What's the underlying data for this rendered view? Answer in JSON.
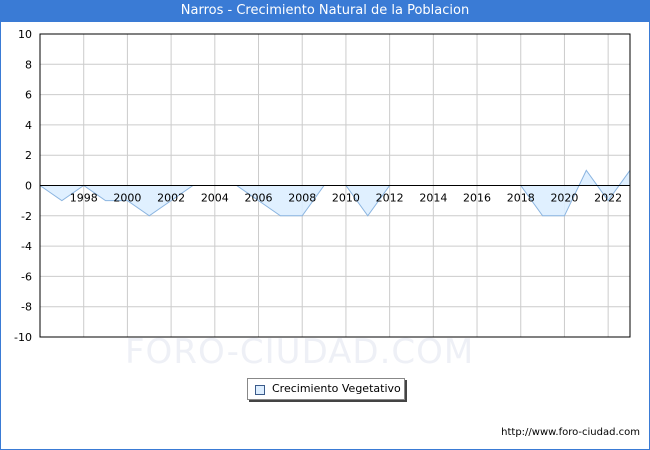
{
  "header": {
    "title": "Narros - Crecimiento Natural de la Poblacion"
  },
  "watermark": "FORO-CIUDAD.COM",
  "footer": {
    "url": "http://www.foro-ciudad.com"
  },
  "colors": {
    "title_bar": "#3a7bd5",
    "area_fill": "#ddeeff",
    "area_line": "#8ab4e0",
    "zero_line": "#000000",
    "grid": "#cccccc"
  },
  "chart_data": {
    "type": "area",
    "title": "Narros - Crecimiento Natural de la Poblacion",
    "xlabel": "",
    "ylabel": "",
    "ylim": [
      -10,
      10
    ],
    "xlim": [
      1996,
      2023
    ],
    "yticks": [
      10,
      8,
      6,
      4,
      2,
      0,
      -2,
      -4,
      -6,
      -8,
      -10
    ],
    "xticks": [
      1998,
      2000,
      2002,
      2004,
      2006,
      2008,
      2010,
      2012,
      2014,
      2016,
      2018,
      2020,
      2022
    ],
    "grid": true,
    "legend_position": "bottom-center",
    "series": [
      {
        "name": "Crecimiento Vegetativo",
        "x": [
          1996,
          1997,
          1998,
          1999,
          2000,
          2001,
          2002,
          2003,
          2004,
          2005,
          2006,
          2007,
          2008,
          2009,
          2010,
          2011,
          2012,
          2013,
          2014,
          2015,
          2016,
          2017,
          2018,
          2019,
          2020,
          2021,
          2022,
          2023
        ],
        "values": [
          0,
          -1,
          0,
          -1,
          -1,
          -2,
          -1,
          0,
          0,
          0,
          -1,
          -2,
          -2,
          0,
          0,
          -2,
          0,
          0,
          0,
          0,
          0,
          0,
          0,
          -2,
          -2,
          1,
          -1,
          1
        ]
      }
    ]
  }
}
